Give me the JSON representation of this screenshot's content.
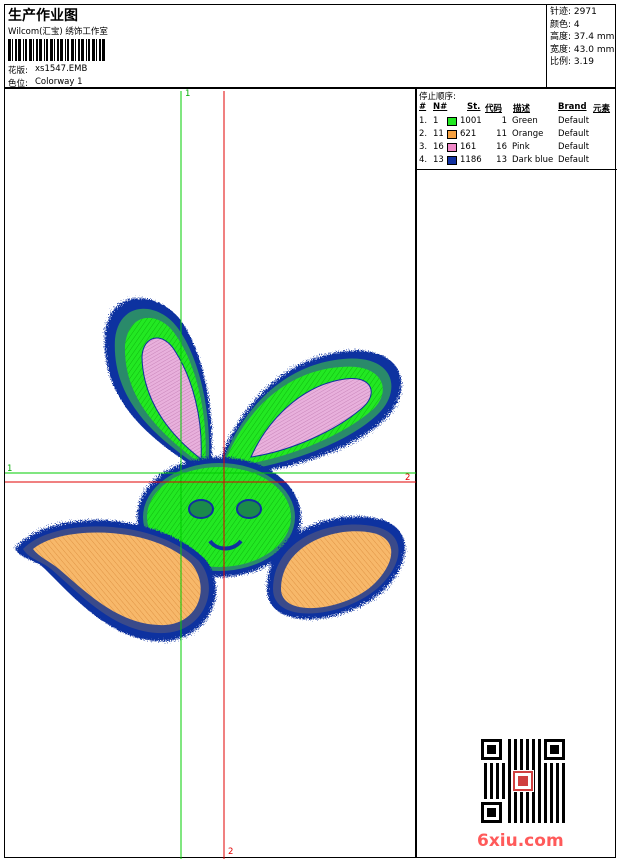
{
  "header": {
    "title": "生产作业图",
    "company": "Wilcom(汇宝) 绣饰工作室",
    "design_label": "花版:",
    "design_name": "xs1547.EMB",
    "colorway_label": "色位:",
    "colorway_name": "Colorway 1"
  },
  "stats": [
    {
      "label": "针迹:",
      "value": "2971"
    },
    {
      "label": "颜色:",
      "value": "4"
    },
    {
      "label": "高度:",
      "value": "37.4 mm"
    },
    {
      "label": "宽度:",
      "value": "43.0 mm"
    },
    {
      "label": "比例:",
      "value": "3.19"
    }
  ],
  "stop_sequence": {
    "title": "停止顺序:",
    "columns": [
      "#",
      "N#",
      "St.",
      "代码",
      "描述",
      "Brand",
      "元素"
    ],
    "rows": [
      {
        "num": "1.",
        "n": "1",
        "color": "#22e822",
        "st": "1001",
        "code": "1",
        "desc": "Green",
        "brand": "Default"
      },
      {
        "num": "2.",
        "n": "11",
        "color": "#f5a040",
        "st": "621",
        "code": "11",
        "desc": "Orange",
        "brand": "Default"
      },
      {
        "num": "3.",
        "n": "16",
        "color": "#f088c8",
        "st": "161",
        "code": "16",
        "desc": "Pink",
        "brand": "Default"
      },
      {
        "num": "4.",
        "n": "13",
        "color": "#1030a0",
        "st": "1186",
        "code": "13",
        "desc": "Dark blue",
        "brand": "Default"
      }
    ]
  },
  "axes": {
    "vertical_top": "1",
    "vertical_bottom": "2",
    "horizontal_left": "1",
    "horizontal_right": "2"
  },
  "watermark": "6xiu.com",
  "colors": {
    "green": "#22e822",
    "orange": "#f5a040",
    "pink": "#f088c8",
    "dark_blue": "#1030a0",
    "axis_green": "#00cc00",
    "axis_red": "#e00000"
  }
}
